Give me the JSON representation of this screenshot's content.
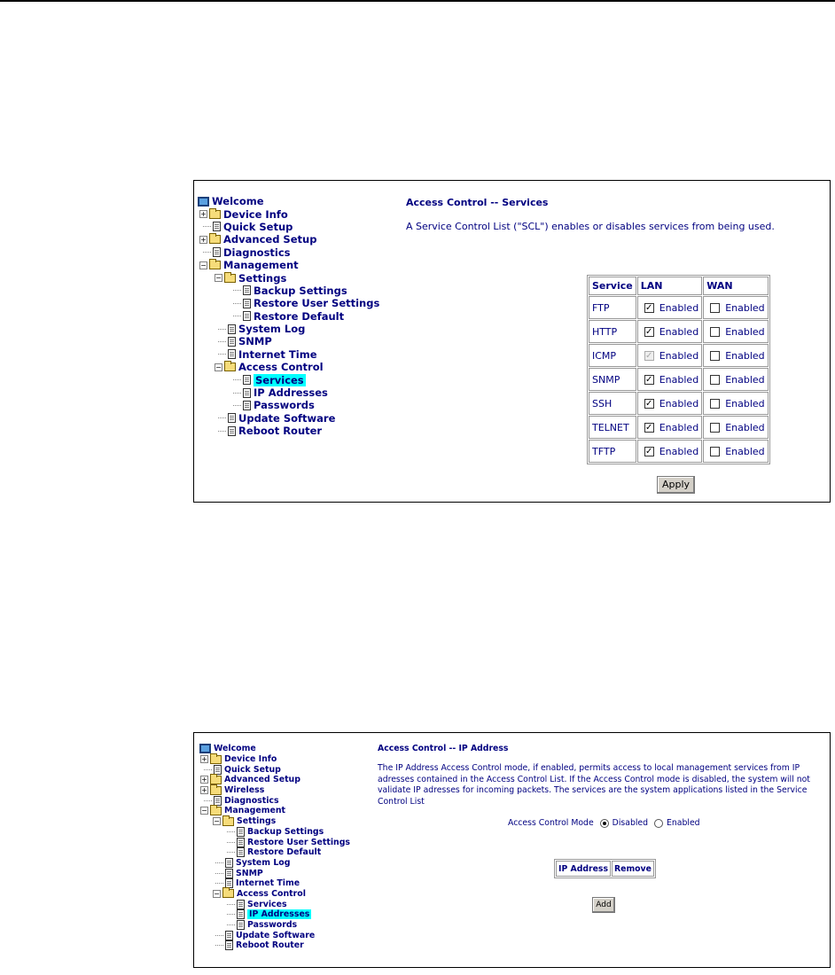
{
  "screenshot1": {
    "tree": {
      "welcome": "Welcome",
      "device_info": "Device Info",
      "quick_setup": "Quick Setup",
      "advanced_setup": "Advanced Setup",
      "diagnostics": "Diagnostics",
      "management": "Management",
      "settings": "Settings",
      "backup_settings": "Backup Settings",
      "restore_user_settings": "Restore User Settings",
      "restore_default": "Restore Default",
      "system_log": "System Log",
      "snmp": "SNMP",
      "internet_time": "Internet Time",
      "access_control": "Access Control",
      "services": "Services",
      "ip_addresses": "IP Addresses",
      "passwords": "Passwords",
      "update_software": "Update Software",
      "reboot_router": "Reboot Router"
    },
    "title": "Access Control -- Services",
    "description": "A Service Control List (\"SCL\") enables or disables services from being used.",
    "table": {
      "headers": [
        "Service",
        "LAN",
        "WAN"
      ],
      "enabled_label": "Enabled",
      "rows": [
        {
          "service": "FTP",
          "lan": true,
          "wan": false
        },
        {
          "service": "HTTP",
          "lan": true,
          "wan": false
        },
        {
          "service": "ICMP",
          "lan": true,
          "wan": false
        },
        {
          "service": "SNMP",
          "lan": true,
          "wan": false
        },
        {
          "service": "SSH",
          "lan": true,
          "wan": false
        },
        {
          "service": "TELNET",
          "lan": true,
          "wan": false
        },
        {
          "service": "TFTP",
          "lan": true,
          "wan": false
        }
      ]
    },
    "apply_label": "Apply"
  },
  "screenshot2": {
    "tree": {
      "welcome": "Welcome",
      "device_info": "Device Info",
      "quick_setup": "Quick Setup",
      "advanced_setup": "Advanced Setup",
      "wireless": "Wireless",
      "diagnostics": "Diagnostics",
      "management": "Management",
      "settings": "Settings",
      "backup_settings": "Backup Settings",
      "restore_user_settings": "Restore User Settings",
      "restore_default": "Restore Default",
      "system_log": "System Log",
      "snmp": "SNMP",
      "internet_time": "Internet Time",
      "access_control": "Access Control",
      "services": "Services",
      "ip_addresses": "IP Addresses",
      "passwords": "Passwords",
      "update_software": "Update Software",
      "reboot_router": "Reboot Router"
    },
    "title": "Access Control -- IP Address",
    "description": "The IP Address Access Control mode, if enabled, permits access to local management services from IP adresses contained in the Access Control List. If the Access Control mode is disabled, the system will not validate IP adresses for incoming packets. The services are the system applications listed in the Service Control List",
    "mode_label": "Access Control Mode",
    "mode_disabled": "Disabled",
    "mode_enabled": "Enabled",
    "mode_selected": "Disabled",
    "table_headers": [
      "IP Address",
      "Remove"
    ],
    "add_label": "Add"
  },
  "colors": {
    "link": "#000080",
    "selected_bg": "#00ffff"
  }
}
